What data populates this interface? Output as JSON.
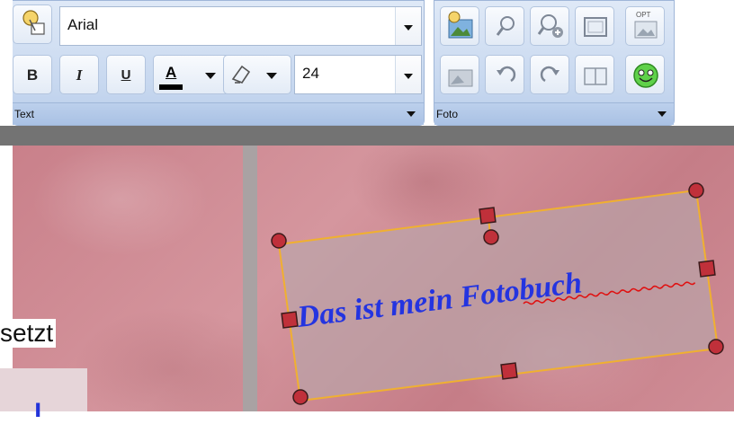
{
  "text_panel": {
    "font_name": "Arial",
    "font_size": "24",
    "bold_label": "B",
    "italic_label": "I",
    "underline_label": "U",
    "font_color_label": "A",
    "font_color": "#000000",
    "section_label": "Text"
  },
  "foto_panel": {
    "section_label": "Foto",
    "opt_badge": "OPT"
  },
  "canvas": {
    "textbox_text": "Das ist mein Fotobuch",
    "textbox_color": "#2434e0",
    "cropped_text": "setzt"
  },
  "colors": {
    "toolbar": "#c6d7ef",
    "canvas_bg": "#cf8d96",
    "handle": "#c0303a",
    "frame": "#f0b030"
  },
  "icons": [
    "shapes-icon",
    "bold-icon",
    "italic-icon",
    "underline-icon",
    "font-color-icon",
    "highlight-icon",
    "insert-photo-icon",
    "zoom-out-icon",
    "zoom-in-icon",
    "frame-icon",
    "opt-photo-icon",
    "photo-effect-icon",
    "undo-rotate-icon",
    "redo-rotate-icon",
    "split-view-icon",
    "smiley-icon"
  ]
}
